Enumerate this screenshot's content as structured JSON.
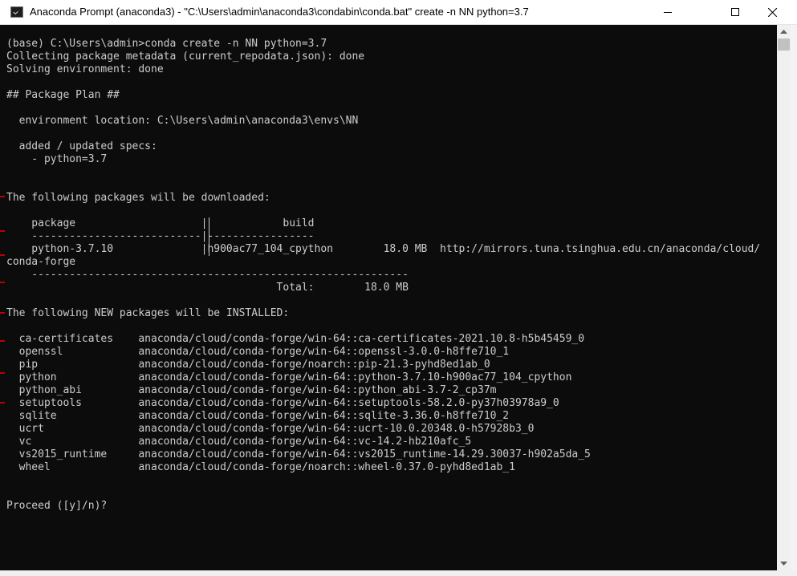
{
  "window": {
    "title": "Anaconda Prompt (anaconda3) - \"C:\\Users\\admin\\anaconda3\\condabin\\conda.bat\"  create -n NN python=3.7"
  },
  "terminal": {
    "lines": [
      "(base) C:\\Users\\admin>conda create -n NN python=3.7",
      "Collecting package metadata (current_repodata.json): done",
      "Solving environment: done",
      "",
      "## Package Plan ##",
      "",
      "  environment location: C:\\Users\\admin\\anaconda3\\envs\\NN",
      "",
      "  added / updated specs:",
      "    - python=3.7",
      "",
      "",
      "The following packages will be downloaded:",
      "",
      "    package                    |            build",
      "    ---------------------------|-----------------",
      "    python-3.7.10              |h900ac77_104_cpython        18.0 MB  http://mirrors.tuna.tsinghua.edu.cn/anaconda/cloud/",
      "conda-forge",
      "    ------------------------------------------------------------",
      "                                           Total:        18.0 MB",
      "",
      "The following NEW packages will be INSTALLED:",
      "",
      "  ca-certificates    anaconda/cloud/conda-forge/win-64::ca-certificates-2021.10.8-h5b45459_0",
      "  openssl            anaconda/cloud/conda-forge/win-64::openssl-3.0.0-h8ffe710_1",
      "  pip                anaconda/cloud/conda-forge/noarch::pip-21.3-pyhd8ed1ab_0",
      "  python             anaconda/cloud/conda-forge/win-64::python-3.7.10-h900ac77_104_cpython",
      "  python_abi         anaconda/cloud/conda-forge/win-64::python_abi-3.7-2_cp37m",
      "  setuptools         anaconda/cloud/conda-forge/win-64::setuptools-58.2.0-py37h03978a9_0",
      "  sqlite             anaconda/cloud/conda-forge/win-64::sqlite-3.36.0-h8ffe710_2",
      "  ucrt               anaconda/cloud/conda-forge/win-64::ucrt-10.0.20348.0-h57928b3_0",
      "  vc                 anaconda/cloud/conda-forge/win-64::vc-14.2-hb210afc_5",
      "  vs2015_runtime     anaconda/cloud/conda-forge/win-64::vs2015_runtime-14.29.30037-h902a5da_5",
      "  wheel              anaconda/cloud/conda-forge/noarch::wheel-0.37.0-pyhd8ed1ab_1",
      "",
      "",
      "Proceed ([y]/n)?"
    ]
  },
  "icons": {
    "app": "terminal-app-icon",
    "minimize": "minimize-icon",
    "maximize": "maximize-icon",
    "close": "close-icon"
  },
  "colors": {
    "terminal_bg": "#0c0c0c",
    "terminal_fg": "#cccccc",
    "titlebar_bg": "#ffffff"
  }
}
